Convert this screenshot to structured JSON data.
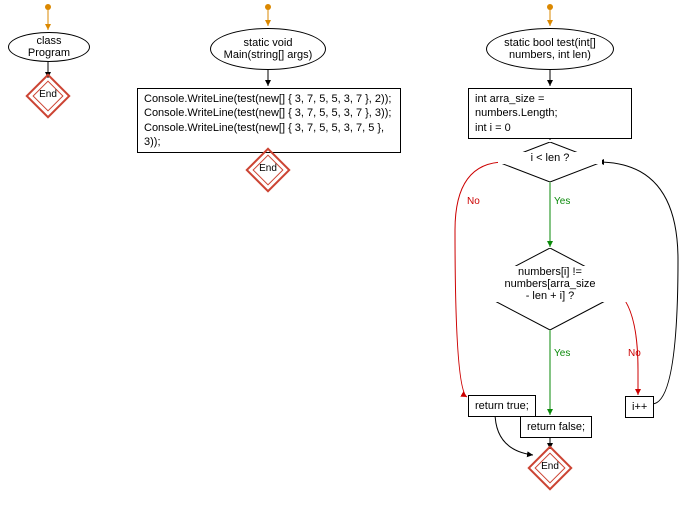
{
  "flow1": {
    "start_label": "class Program",
    "end_label": "End"
  },
  "flow2": {
    "start_label": "static void\nMain(string[] args)",
    "code": "Console.WriteLine(test(new[] { 3, 7, 5, 5, 3, 7 }, 2));\nConsole.WriteLine(test(new[] { 3, 7, 5, 5, 3, 7 }, 3));\nConsole.WriteLine(test(new[] { 3, 7, 5, 5, 3, 7, 5 }, 3));",
    "end_label": "End"
  },
  "flow3": {
    "start_label": "static bool test(int[]\nnumbers, int len)",
    "init": "int arra_size = numbers.Length;\nint i = 0",
    "cond1": "i < len ?",
    "cond2": "numbers[i] !=\nnumbers[arra_size\n- len + i] ?",
    "branch_true": "return true;",
    "branch_false": "return false;",
    "increment": "i++",
    "end_label": "End"
  },
  "labels": {
    "yes": "Yes",
    "no": "No"
  }
}
